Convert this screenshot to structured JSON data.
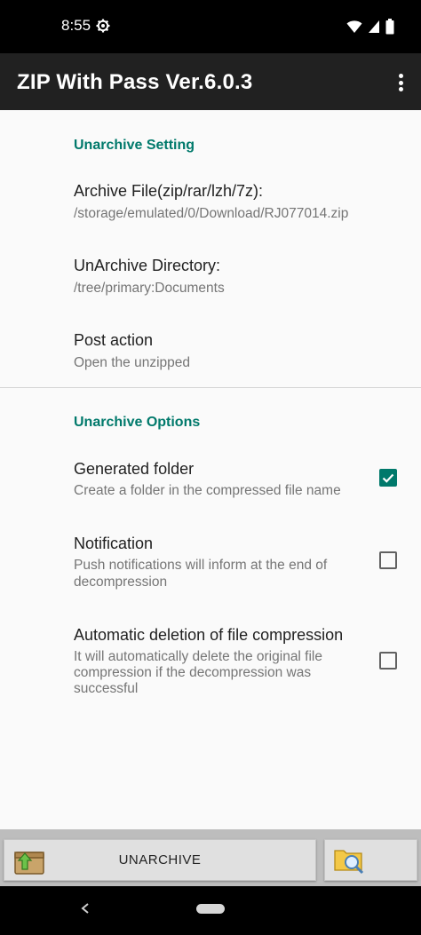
{
  "status_bar": {
    "time": "8:55"
  },
  "app_bar": {
    "title": "ZIP With Pass Ver.6.0.3"
  },
  "unarchive_setting": {
    "header": "Unarchive Setting",
    "archive_file": {
      "title": "Archive File(zip/rar/lzh/7z):",
      "summary": "/storage/emulated/0/Download/RJ077014.zip"
    },
    "unarchive_directory": {
      "title": "UnArchive Directory:",
      "summary": "/tree/primary:Documents"
    },
    "post_action": {
      "title": "Post action",
      "summary": "Open the unzipped"
    }
  },
  "unarchive_options": {
    "header": "Unarchive Options",
    "generated_folder": {
      "title": "Generated folder",
      "summary": "Create a folder in the compressed file name",
      "checked": true
    },
    "notification": {
      "title": "Notification",
      "summary_line1": "Push notifications will inform at the end of",
      "summary_line2": "decompression",
      "checked": false
    },
    "auto_delete": {
      "title": "Automatic deletion of file compression",
      "summary_line1": "It will automatically delete the original file",
      "summary_line2": "compression if the decompression was",
      "summary_line3": "successful",
      "checked": false
    }
  },
  "bottom_bar": {
    "unarchive_label": "UNARCHIVE"
  },
  "colors": {
    "accent": "#00796b",
    "app_bar": "#212121",
    "status_bar": "#000000"
  },
  "icons": {
    "status_gear": "gear-icon",
    "wifi": "wifi-icon",
    "signal": "signal-icon",
    "battery": "battery-icon",
    "overflow": "more-vert-icon",
    "unarchive": "archive-box-icon",
    "browse": "folder-search-icon",
    "back": "back-icon",
    "home": "home-pill"
  }
}
